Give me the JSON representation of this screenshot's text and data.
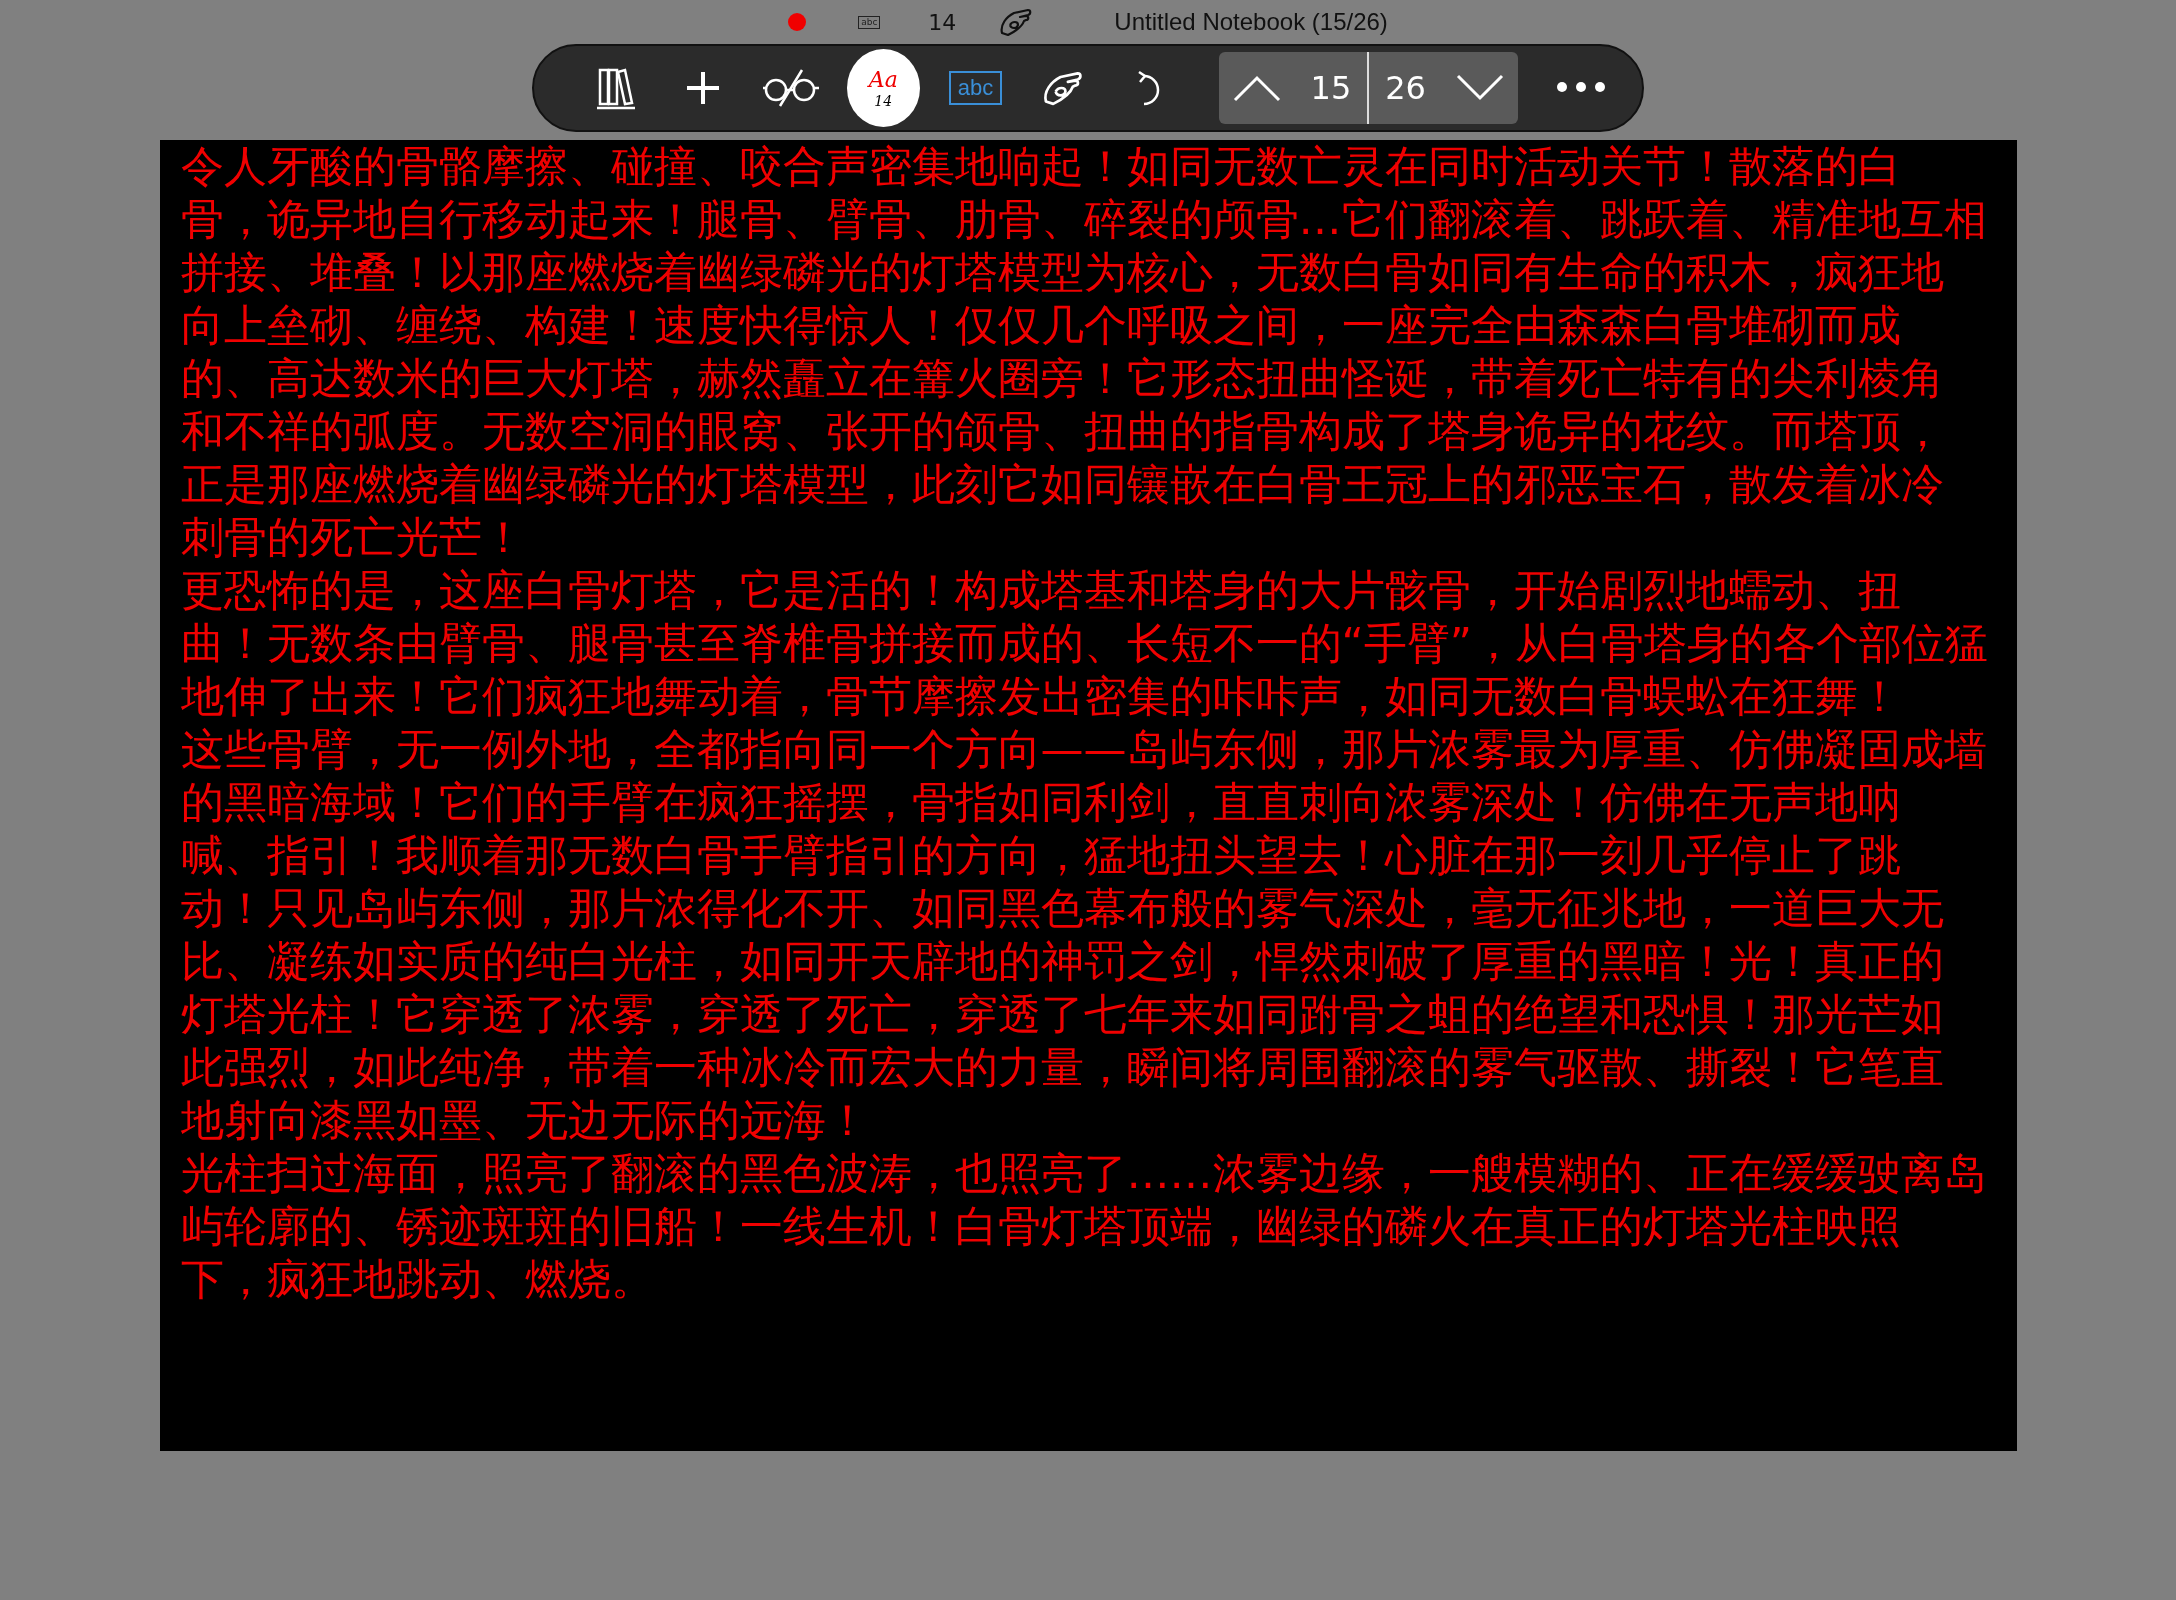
{
  "status_bar": {
    "recording": true,
    "keyboard_label": "abc",
    "font_size": "14",
    "title": "Untitled Notebook (15/26)"
  },
  "toolbar": {
    "tools": [
      {
        "kind": "library",
        "selected": false
      },
      {
        "kind": "add",
        "selected": false
      },
      {
        "kind": "glasses",
        "selected": false
      },
      {
        "kind": "pen",
        "selected": true,
        "sample": "Aa",
        "size": "14"
      },
      {
        "kind": "text",
        "selected": false,
        "label": "abc"
      },
      {
        "kind": "hand",
        "selected": false
      },
      {
        "kind": "undo",
        "selected": false
      }
    ],
    "page_nav": {
      "current": "15",
      "total": "26"
    }
  },
  "page": {
    "paragraphs": [
      {
        "lines": [
          "令人牙酸的骨骼摩擦、碰撞、咬合声密集地响起！如同无数亡灵在同时活动关节！散落的白",
          "骨，诡异地自行移动起来！腿骨、臂骨、肋骨、碎裂的颅骨…它们翻滚着、跳跃着、精准地互相",
          "拼接、堆叠！以那座燃烧着幽绿磷光的灯塔模型为核心，无数白骨如同有生命的积木，疯狂地",
          "向上垒砌、缠绕、构建！速度快得惊人！仅仅几个呼吸之间，一座完全由森森白骨堆砌而成",
          "的、高达数米的巨大灯塔，赫然矗立在篝火圈旁！它形态扭曲怪诞，带着死亡特有的尖利棱角",
          "和不祥的弧度。无数空洞的眼窝、张开的颌骨、扭曲的指骨构成了塔身诡异的花纹。而塔顶，",
          "正是那座燃烧着幽绿磷光的灯塔模型，此刻它如同镶嵌在白骨王冠上的邪恶宝石，散发着冰冷",
          "刺骨的死亡光芒！"
        ]
      },
      {
        "lines": [
          "更恐怖的是，这座白骨灯塔，它是活的！构成塔基和塔身的大片骸骨，开始剧烈地蠕动、扭",
          "曲！无数条由臂骨、腿骨甚至脊椎骨拼接而成的、长短不一的“手臂”，从白骨塔身的各个部位猛",
          "地伸了出来！它们疯狂地舞动着，骨节摩擦发出密集的咔咔声，如同无数白骨蜈蚣在狂舞！",
          "这些骨臂，无一例外地，全都指向同一个方向——岛屿东侧，那片浓雾最为厚重、仿佛凝固成墙",
          "的黑暗海域！它们的手臂在疯狂摇摆，骨指如同利剑，直直刺向浓雾深处！仿佛在无声地呐",
          "喊、指引！我顺着那无数白骨手臂指引的方向，猛地扭头望去！心脏在那一刻几乎停止了跳",
          "动！只见岛屿东侧，那片浓得化不开、如同黑色幕布般的雾气深处，毫无征兆地，一道巨大无",
          "比、凝练如实质的纯白光柱，如同开天辟地的神罚之剑，悍然刺破了厚重的黑暗！光！真正的",
          "灯塔光柱！它穿透了浓雾，穿透了死亡，穿透了七年来如同跗骨之蛆的绝望和恐惧！那光芒如",
          "此强烈，如此纯净，带着一种冰冷而宏大的力量，瞬间将周围翻滚的雾气驱散、撕裂！它笔直",
          "地射向漆黑如墨、无边无际的远海！"
        ]
      },
      {
        "lines": [
          "光柱扫过海面，照亮了翻滚的黑色波涛，也照亮了……浓雾边缘，一艘模糊的、正在缓缓驶离岛",
          "屿轮廓的、锈迹斑斑的旧船！一线生机！白骨灯塔顶端，幽绿的磷火在真正的灯塔光柱映照",
          "下，疯狂地跳动、燃烧。"
        ]
      }
    ]
  }
}
